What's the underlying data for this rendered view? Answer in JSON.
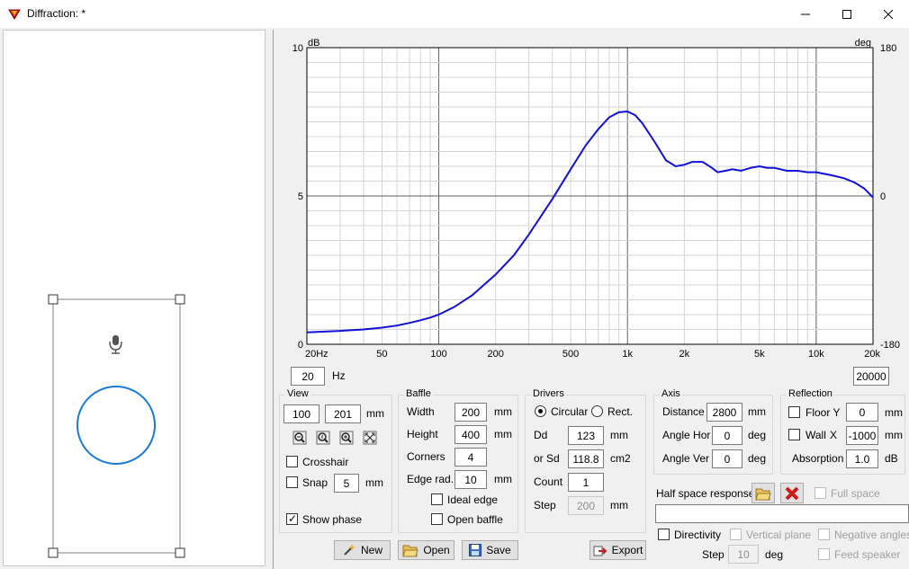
{
  "window": {
    "title": "Diffraction: *"
  },
  "chart_data": {
    "type": "line",
    "xscale": "log",
    "xlim": [
      20,
      20000
    ],
    "ylim": [
      0,
      10
    ],
    "y2lim": [
      -180,
      180
    ],
    "y_unit": "dB",
    "y2_unit": "deg",
    "x_tick_labels": [
      "20Hz",
      "50",
      "100",
      "200",
      "500",
      "1k",
      "2k",
      "5k",
      "10k",
      "20k"
    ],
    "x_tick_values": [
      20,
      50,
      100,
      200,
      500,
      1000,
      2000,
      5000,
      10000,
      20000
    ],
    "y_tick_labels": [
      "0",
      "5",
      "10"
    ],
    "y2_tick_labels": [
      "-180",
      "0",
      "180"
    ],
    "grid": true,
    "series": [
      {
        "color": "#1010d8",
        "x": [
          20,
          30,
          40,
          50,
          60,
          70,
          80,
          90,
          100,
          120,
          150,
          200,
          250,
          300,
          400,
          500,
          600,
          700,
          800,
          900,
          1000,
          1100,
          1200,
          1400,
          1600,
          1800,
          2000,
          2200,
          2500,
          2800,
          3000,
          3300,
          3600,
          4000,
          4500,
          5000,
          5500,
          6000,
          7000,
          8000,
          9000,
          10000,
          12000,
          14000,
          16000,
          18000,
          20000
        ],
        "y": [
          0.4,
          0.45,
          0.5,
          0.56,
          0.63,
          0.72,
          0.81,
          0.9,
          1.0,
          1.25,
          1.65,
          2.35,
          3.0,
          3.7,
          4.9,
          5.9,
          6.7,
          7.25,
          7.65,
          7.82,
          7.85,
          7.72,
          7.45,
          6.8,
          6.2,
          6.0,
          6.05,
          6.15,
          6.15,
          5.95,
          5.8,
          5.85,
          5.9,
          5.85,
          5.95,
          6.0,
          5.95,
          5.95,
          5.85,
          5.85,
          5.8,
          5.8,
          5.7,
          5.6,
          5.45,
          5.25,
          4.95
        ]
      }
    ]
  },
  "freq": {
    "min": "20",
    "unit": "Hz",
    "max": "20000"
  },
  "view": {
    "title": "View",
    "w": "100",
    "h": "201",
    "unit": "mm",
    "crosshair": "Crosshair",
    "snap": "Snap",
    "snap_value": "5",
    "snap_unit": "mm",
    "show_phase": "Show phase",
    "show_phase_checked": true
  },
  "baffle": {
    "title": "Baffle",
    "width_label": "Width",
    "width": "200",
    "height_label": "Height",
    "height": "400",
    "corners_label": "Corners",
    "corners": "4",
    "edge_label": "Edge rad.",
    "edge": "10",
    "unit": "mm",
    "ideal_edge": "Ideal edge",
    "open_baffle": "Open baffle"
  },
  "drivers": {
    "title": "Drivers",
    "circular": "Circular",
    "rect": "Rect.",
    "dd_label": "Dd",
    "dd": "123",
    "dd_unit": "mm",
    "sd_label": "or Sd",
    "sd": "118.8",
    "sd_unit": "cm2",
    "count_label": "Count",
    "count": "1",
    "step_label": "Step",
    "step": "200",
    "step_unit": "mm"
  },
  "axis": {
    "title": "Axis",
    "distance_label": "Distance",
    "distance": "2800",
    "distance_unit": "mm",
    "angle_hor_label": "Angle Hor",
    "angle_hor": "0",
    "angle_ver_label": "Angle Ver",
    "angle_ver": "0",
    "angle_unit": "deg"
  },
  "reflection": {
    "title": "Reflection",
    "floor_label": "Floor Y",
    "floor": "0",
    "unit": "mm",
    "wall_label": "Wall",
    "wall_axis": "X",
    "wall": "-1000",
    "absorption_label": "Absorption",
    "absorption": "1.0",
    "absorption_unit": "dB"
  },
  "half_space": {
    "label": "Half space response",
    "full_space": "Full space",
    "value": ""
  },
  "directivity": {
    "label": "Directivity",
    "vertical_plane": "Vertical plane",
    "negative_angles": "Negative angles",
    "step_label": "Step",
    "step": "10",
    "step_unit": "deg",
    "feed_speaker": "Feed speaker"
  },
  "buttons": {
    "new": "New",
    "open": "Open",
    "save": "Save",
    "export": "Export"
  }
}
